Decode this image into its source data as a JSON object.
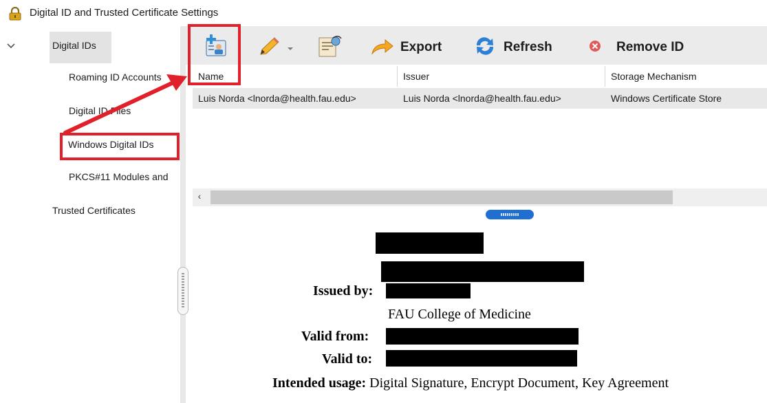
{
  "window": {
    "title": "Digital ID and Trusted Certificate Settings",
    "icon": "lock-icon"
  },
  "sidebar": {
    "items": [
      {
        "label": "Digital IDs",
        "selected": true,
        "expanded": true
      },
      {
        "label": "Roaming ID Accounts"
      },
      {
        "label": "Digital ID Files"
      },
      {
        "label": "Windows Digital IDs",
        "highlighted": true
      },
      {
        "label": "PKCS#11 Modules and"
      },
      {
        "label": "Trusted Certificates"
      }
    ]
  },
  "toolbar": {
    "add_icon": "add-id-icon",
    "edit_icon": "pencil-icon",
    "cert_icon": "certificate-icon",
    "export_label": "Export",
    "refresh_label": "Refresh",
    "remove_label": "Remove ID"
  },
  "table": {
    "columns": [
      "Name",
      "Issuer",
      "Storage Mechanism"
    ],
    "rows": [
      {
        "name": "Luis Norda <lnorda@health.fau.edu>",
        "issuer": "Luis Norda <lnorda@health.fau.edu>",
        "storage": "Windows Certificate Store"
      }
    ]
  },
  "details": {
    "issued_by_label": "Issued by:",
    "issuer_org": "FAU College of Medicine",
    "valid_from_label": "Valid from:",
    "valid_to_label": "Valid to:",
    "intended_usage_label": "Intended usage:",
    "intended_usage_value": "Digital Signature, Encrypt Document, Key Agreement"
  },
  "colors": {
    "annotation_red": "#e0202a",
    "toolbar_bg": "#ebebeb",
    "selected_row": "#e8e8e8",
    "grip_blue": "#1f6fd1"
  }
}
